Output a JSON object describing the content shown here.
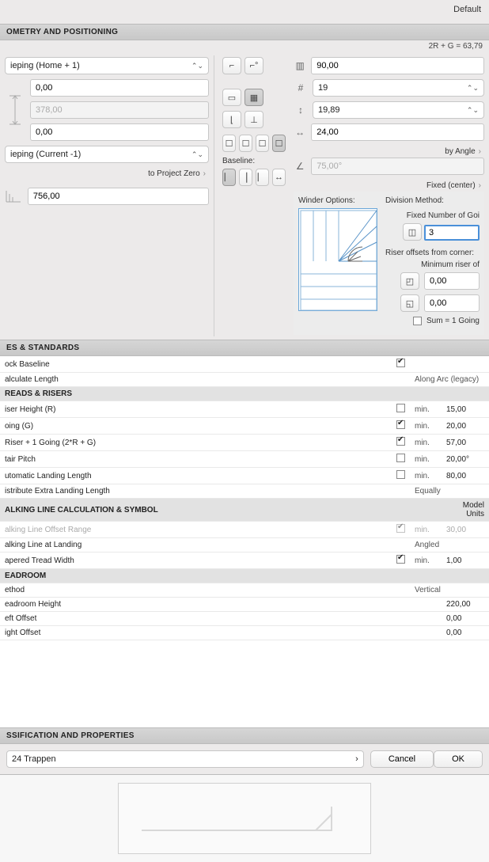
{
  "topbar": {
    "preset": "Default"
  },
  "sections": {
    "geometry": "OMETRY AND POSITIONING",
    "rules": "ES & STANDARDS",
    "class": "SSIFICATION AND PROPERTIES"
  },
  "formula": "2R + G = 63,79",
  "left": {
    "topStory": "ieping (Home + 1)",
    "offset1": "0,00",
    "thickness": "378,00",
    "offset2": "0,00",
    "bottomStory": "ieping (Current -1)",
    "projectZero": "to Project Zero",
    "totalHeight": "756,00"
  },
  "right": {
    "riseTotal": "90,00",
    "risers": "19",
    "going": "19,89",
    "tread": "24,00",
    "angleLink": "by Angle",
    "angle": "75,00°",
    "fixedLink": "Fixed (center)",
    "baselineLabel": "Baseline:"
  },
  "winder": {
    "optionsLabel": "Winder Options:",
    "divisionLabel": "Division Method:",
    "fixedGoings": "Fixed Number of Goi",
    "fixedGoingsValue": "3",
    "riserOffsets": "Riser offsets from corner:",
    "minRiser": "Minimum riser of",
    "off1": "0,00",
    "off2": "0,00",
    "sumLabel": "Sum = 1 Going"
  },
  "rules": {
    "rows": [
      {
        "label": "ock Baseline",
        "chk": true,
        "min": "",
        "val": ""
      },
      {
        "label": "alculate Length",
        "chk": null,
        "min": "",
        "val": "Along Arc (legacy)"
      }
    ],
    "treadsHeader": "READS & RISERS",
    "treads": [
      {
        "label": "iser Height (R)",
        "chk": false,
        "min": "min.",
        "val": "15,00"
      },
      {
        "label": "oing (G)",
        "chk": true,
        "min": "min.",
        "val": "20,00"
      },
      {
        "label": " Riser + 1 Going (2*R + G)",
        "chk": true,
        "min": "min.",
        "val": "57,00"
      },
      {
        "label": "tair Pitch",
        "chk": false,
        "min": "min.",
        "val": "20,00°"
      },
      {
        "label": "utomatic Landing Length",
        "chk": false,
        "min": "min.",
        "val": "80,00"
      },
      {
        "label": "istribute Extra Landing Length",
        "chk": null,
        "min": "",
        "val": "Equally"
      }
    ],
    "walkHeader": "ALKING LINE CALCULATION & SYMBOL",
    "walk": [
      {
        "label": "alking Line Offset Range",
        "chk": true,
        "dim": true,
        "min": "min.",
        "val": "30,00"
      },
      {
        "label": "alking Line at Landing",
        "chk": null,
        "min": "",
        "val": "Angled"
      },
      {
        "label": "apered Tread Width",
        "chk": true,
        "min": "min.",
        "val": "1,00"
      }
    ],
    "headHeader": "EADROOM",
    "head": [
      {
        "label": "ethod",
        "val": "Vertical"
      },
      {
        "label": "eadroom Height",
        "val": "220,00"
      },
      {
        "label": "eft Offset",
        "val": "0,00"
      },
      {
        "label": "ight Offset",
        "val": "0,00"
      }
    ],
    "modelUnits": "Model Units"
  },
  "class": {
    "value": "24 Trappen"
  },
  "buttons": {
    "cancel": "Cancel",
    "ok": "OK"
  }
}
